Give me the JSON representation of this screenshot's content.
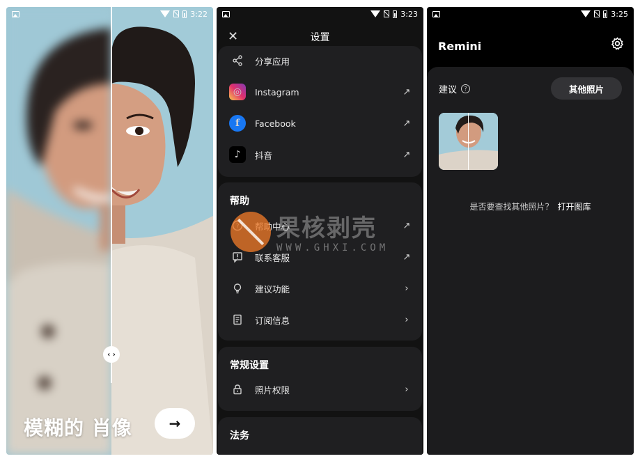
{
  "screen1": {
    "status": {
      "time": "3:22"
    },
    "title": "模糊的 肖像",
    "next_arrow": "→",
    "handle": "‹ ›"
  },
  "screen2": {
    "status": {
      "time": "3:23"
    },
    "header_title": "设置",
    "close_glyph": "✕",
    "share_row": {
      "label": "分享应用"
    },
    "social": [
      {
        "label": "Instagram",
        "trail": "↗"
      },
      {
        "label": "Facebook",
        "trail": "↗"
      },
      {
        "label": "抖音",
        "trail": "↗"
      }
    ],
    "help_section": {
      "title": "帮助",
      "items": [
        {
          "label": "帮助中心",
          "trail": "↗"
        },
        {
          "label": "联系客服",
          "trail": "↗"
        },
        {
          "label": "建议功能",
          "trail": "›"
        },
        {
          "label": "订阅信息",
          "trail": "›"
        }
      ]
    },
    "general_section": {
      "title": "常规设置",
      "items": [
        {
          "label": "照片权限",
          "trail": "›"
        }
      ]
    },
    "legal_section": {
      "title": "法务"
    },
    "watermark": {
      "text": "果核剥壳",
      "url": "WWW.GHXI.COM"
    }
  },
  "screen3": {
    "status": {
      "time": "3:25"
    },
    "brand": "Remini",
    "suggest_label": "建议",
    "other_photos_button": "其他照片",
    "prompt_text": "是否要查找其他照片？",
    "open_gallery_link": "打开图库"
  },
  "colors": {
    "settings_bg": "#121212",
    "card_bg": "#1f1f21",
    "panel_bg": "#1c1c1e",
    "photo_bg": "#9ec6d3"
  }
}
